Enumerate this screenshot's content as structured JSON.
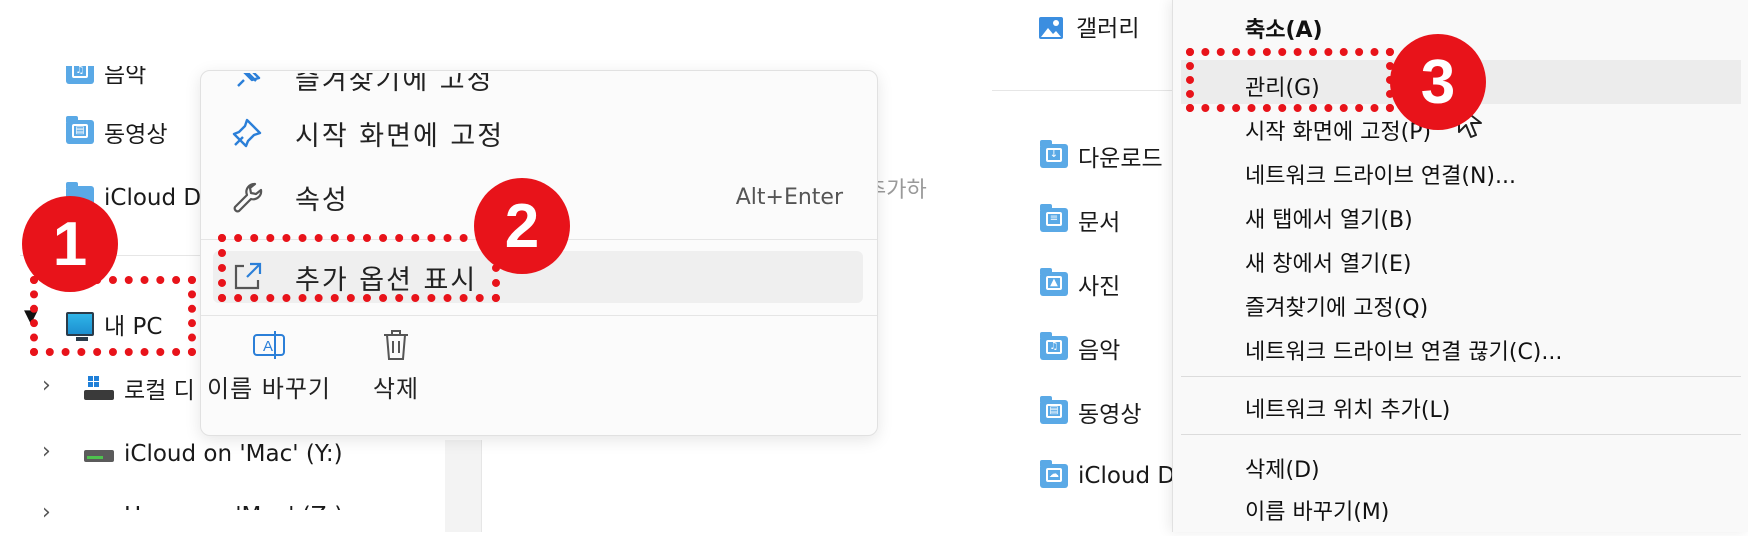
{
  "left_nav": {
    "items": [
      {
        "label": "음악",
        "glyph": "♫"
      },
      {
        "label": "동영상",
        "glyph": "▤"
      },
      {
        "label": "iCloud D"
      },
      {
        "label": "내 PC"
      },
      {
        "label": "로컬 디"
      },
      {
        "label": "iCloud on 'Mac' (Y:)"
      },
      {
        "label": "Home on 'Mac' (Z:)"
      }
    ]
  },
  "bg_text": "추가하",
  "context_menu": {
    "top_item": "즐겨찾기에 고정",
    "items": [
      {
        "label": "시작 화면에 고정",
        "icon": "pin-icon"
      },
      {
        "label": "속성",
        "icon": "wrench-icon",
        "shortcut": "Alt+Enter"
      },
      {
        "label": "추가 옵션 표시",
        "icon": "expand-icon"
      }
    ],
    "bottom_buttons": [
      {
        "label": "이름 바꾸기",
        "icon": "rename-icon"
      },
      {
        "label": "삭제",
        "icon": "trash-icon"
      }
    ]
  },
  "right_nav": {
    "items": [
      {
        "label": "갤러리"
      },
      {
        "label": "다운로드",
        "glyph": "↓"
      },
      {
        "label": "문서",
        "glyph": "≡"
      },
      {
        "label": "사진",
        "glyph": "▲"
      },
      {
        "label": "음악",
        "glyph": "♫"
      },
      {
        "label": "동영상",
        "glyph": "▤"
      },
      {
        "label": "iCloud D",
        "glyph": "☁"
      }
    ]
  },
  "classic_menu": {
    "items": [
      {
        "label": "축소(A)",
        "bold": true
      },
      {
        "label": "관리(G)"
      },
      {
        "label": "시작 화면에 고정(P)"
      },
      {
        "label": "네트워크 드라이브 연결(N)..."
      },
      {
        "label": "새 탭에서 열기(B)"
      },
      {
        "label": "새 창에서 열기(E)"
      },
      {
        "label": "즐겨찾기에 고정(Q)"
      },
      {
        "label": "네트워크 드라이브 연결 끊기(C)..."
      },
      {
        "label": "네트워크 위치 추가(L)"
      },
      {
        "label": "삭제(D)"
      },
      {
        "label": "이름 바꾸기(M)"
      }
    ]
  },
  "annotations": {
    "badges": [
      "1",
      "2",
      "3"
    ],
    "color": "#e8131a"
  }
}
